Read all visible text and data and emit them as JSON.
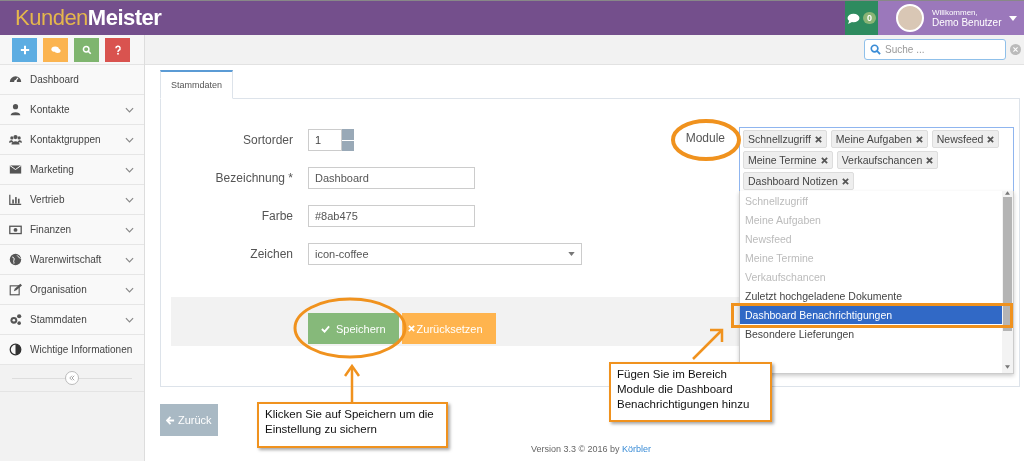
{
  "header": {
    "logo_part_1": "Kunden",
    "logo_part_2": "Meister",
    "messages_count": "0",
    "greeting": "Willkommen,",
    "user_name": "Demo Benutzer"
  },
  "quick_actions": [
    {
      "kind": "add",
      "color": "#5dade2"
    },
    {
      "kind": "chat",
      "color": "#fbb450"
    },
    {
      "kind": "search",
      "color": "#7fb56f"
    },
    {
      "kind": "help",
      "color": "#d9534f"
    }
  ],
  "search": {
    "placeholder": "Suche ..."
  },
  "sidebar": {
    "items": [
      {
        "kind": "dashboard",
        "label": "Dashboard",
        "expandable": false
      },
      {
        "kind": "user",
        "label": "Kontakte",
        "expandable": true
      },
      {
        "kind": "group",
        "label": "Kontaktgruppen",
        "expandable": true
      },
      {
        "kind": "mail",
        "label": "Marketing",
        "expandable": true
      },
      {
        "kind": "chart",
        "label": "Vertrieb",
        "expandable": true
      },
      {
        "kind": "money",
        "label": "Finanzen",
        "expandable": true
      },
      {
        "kind": "globe",
        "label": "Warenwirtschaft",
        "expandable": true
      },
      {
        "kind": "edit",
        "label": "Organisation",
        "expandable": true
      },
      {
        "kind": "gears",
        "label": "Stammdaten",
        "expandable": true
      },
      {
        "kind": "contrast",
        "label": "Wichtige Informationen",
        "expandable": false
      }
    ]
  },
  "tabs": [
    {
      "label": "Stammdaten",
      "selected": true
    }
  ],
  "form": {
    "fields": [
      {
        "kind": "spinner",
        "label": "Sortorder",
        "value": "1"
      },
      {
        "kind": "text",
        "label": "Bezeichnung *",
        "value": "Dashboard"
      },
      {
        "kind": "text",
        "label": "Farbe",
        "value": "#8ab475"
      },
      {
        "kind": "select",
        "label": "Zeichen",
        "value": "icon-coffee"
      }
    ]
  },
  "modules": {
    "label": "Module",
    "tags": [
      "Schnellzugriff",
      "Meine Aufgaben",
      "Newsfeed",
      "Meine Termine",
      "Verkaufschancen",
      "Dashboard Notizen"
    ],
    "options": [
      {
        "label": "Schnellzugriff",
        "disabled": true,
        "selected": false
      },
      {
        "label": "Meine Aufgaben",
        "disabled": true,
        "selected": false
      },
      {
        "label": "Newsfeed",
        "disabled": true,
        "selected": false
      },
      {
        "label": "Meine Termine",
        "disabled": true,
        "selected": false
      },
      {
        "label": "Verkaufschancen",
        "disabled": true,
        "selected": false
      },
      {
        "label": "Zuletzt hochgeladene Dokumente",
        "disabled": false,
        "selected": false
      },
      {
        "label": "Dashboard Benachrichtigungen",
        "disabled": false,
        "selected": true
      },
      {
        "label": "Besondere Lieferungen",
        "disabled": false,
        "selected": false
      }
    ]
  },
  "actions": {
    "save": "Speichern",
    "reset": "Zurücksetzen"
  },
  "back_button": "Zurück",
  "footer": {
    "text": "Version 3.3 © 2016 by",
    "link": "Körbler"
  },
  "annotations": [
    {
      "text": "Klicken Sie auf Speichern um die Einstellung zu sichern"
    },
    {
      "text": "Fügen Sie im Bereich Module die Dashboard Benachrichtigungen hinzu"
    }
  ]
}
